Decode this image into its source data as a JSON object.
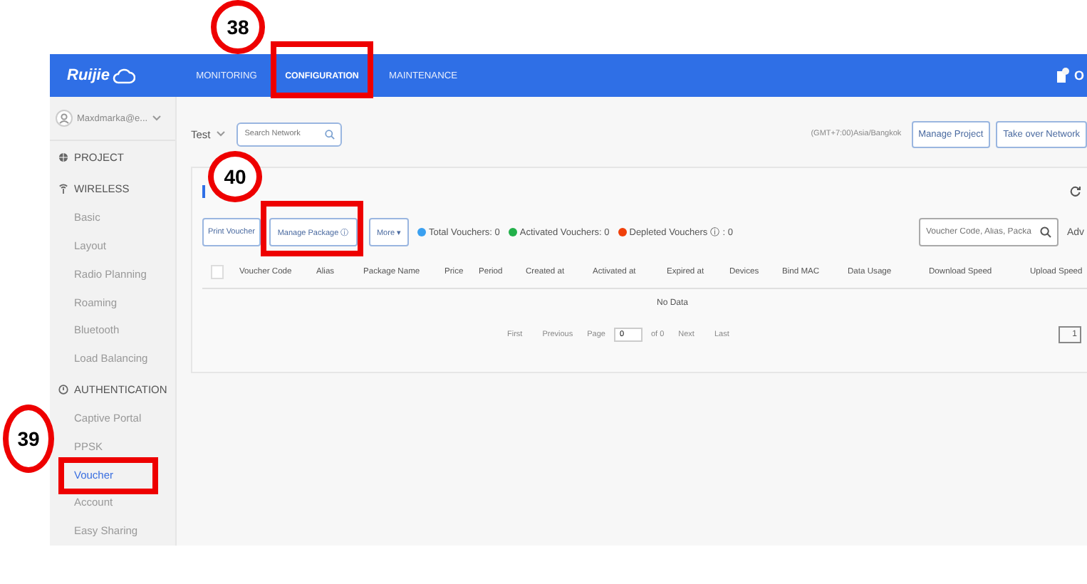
{
  "top_nav": {
    "logo": "Ruijie",
    "items": [
      {
        "label": "MONITORING",
        "selected": false
      },
      {
        "label": "CONFIGURATION",
        "selected": true
      },
      {
        "label": "MAINTENANCE",
        "selected": false
      }
    ],
    "right_text": "O"
  },
  "sidebar": {
    "user": "Maxdmarka@e...",
    "sections": [
      {
        "kind": "globe",
        "label": "PROJECT"
      },
      {
        "kind": "wifi",
        "label": "WIRELESS",
        "items": [
          {
            "label": "Basic",
            "selected": false
          },
          {
            "label": "Layout",
            "selected": false
          },
          {
            "label": "Radio Planning",
            "selected": false
          },
          {
            "label": "Roaming",
            "selected": false
          },
          {
            "label": "Bluetooth",
            "selected": false
          },
          {
            "label": "Load Balancing",
            "selected": false
          }
        ]
      },
      {
        "kind": "shield",
        "label": "AUTHENTICATION",
        "items": [
          {
            "label": "Captive Portal",
            "selected": false
          },
          {
            "label": "PPSK",
            "selected": false
          },
          {
            "label": "Voucher",
            "selected": true
          },
          {
            "label": "Account",
            "selected": false
          },
          {
            "label": "Easy Sharing",
            "selected": false
          }
        ]
      }
    ]
  },
  "header": {
    "network": "Test",
    "search": {
      "placeholder": "Search Network"
    },
    "timezone": "(GMT+7:00)Asia/Bangkok",
    "buttons": [
      "Manage Project",
      "Take over Network"
    ]
  },
  "card": {
    "toolbar": {
      "buttons": [
        "Print Voucher",
        "Manage Package ⓘ",
        "More ▾"
      ],
      "stats": [
        {
          "label": "Total Vouchers: 0",
          "color": "#3aa0f0"
        },
        {
          "label": "Activated Vouchers: 0",
          "color": "#22b04a"
        },
        {
          "label": "Depleted Vouchers  ⓘ : 0",
          "color": "#f0400a"
        }
      ],
      "search": {
        "placeholder": "Voucher Code, Alias, Packa"
      },
      "advanced": "Adv"
    },
    "table": {
      "select_all_checked": false,
      "columns": [
        "Voucher Code",
        "Alias",
        "Package Name",
        "Price",
        "Period",
        "Created at",
        "Activated at",
        "Expired at",
        "Devices",
        "Bind MAC",
        "Data Usage",
        "Download Speed",
        "Upload Speed"
      ],
      "empty_text": "No Data"
    },
    "pagination": {
      "first": "First",
      "previous": "Previous",
      "page_label": "Page",
      "page": "0",
      "of": "of 0",
      "next": "Next",
      "last": "Last",
      "page_size": "1"
    }
  },
  "annotations": [
    {
      "kind": "circle",
      "label": "38"
    },
    {
      "kind": "box"
    },
    {
      "kind": "circle",
      "label": "40"
    },
    {
      "kind": "box"
    },
    {
      "kind": "circle",
      "label": "39"
    },
    {
      "kind": "box"
    }
  ]
}
